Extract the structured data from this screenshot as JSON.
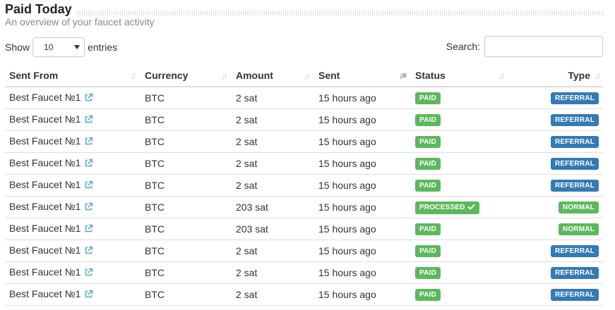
{
  "header": {
    "title": "Paid Today",
    "subtitle": "An overview of your faucet activity"
  },
  "length": {
    "show_label": "Show",
    "selected": "10",
    "entries_label": "entries"
  },
  "search": {
    "label": "Search:",
    "value": ""
  },
  "table": {
    "columns": [
      "Sent From",
      "Currency",
      "Amount",
      "Sent",
      "Status",
      "Type"
    ],
    "active_sort_column": "Sent",
    "rows": [
      {
        "from": "Best Faucet №1",
        "currency": "BTC",
        "amount": "2 sat",
        "sent": "15 hours ago",
        "status": "PAID",
        "type": "REFERRAL"
      },
      {
        "from": "Best Faucet №1",
        "currency": "BTC",
        "amount": "2 sat",
        "sent": "15 hours ago",
        "status": "PAID",
        "type": "REFERRAL"
      },
      {
        "from": "Best Faucet №1",
        "currency": "BTC",
        "amount": "2 sat",
        "sent": "15 hours ago",
        "status": "PAID",
        "type": "REFERRAL"
      },
      {
        "from": "Best Faucet №1",
        "currency": "BTC",
        "amount": "2 sat",
        "sent": "15 hours ago",
        "status": "PAID",
        "type": "REFERRAL"
      },
      {
        "from": "Best Faucet №1",
        "currency": "BTC",
        "amount": "2 sat",
        "sent": "15 hours ago",
        "status": "PAID",
        "type": "REFERRAL"
      },
      {
        "from": "Best Faucet №1",
        "currency": "BTC",
        "amount": "203 sat",
        "sent": "15 hours ago",
        "status": "PROCESSED",
        "type": "NORMAL"
      },
      {
        "from": "Best Faucet №1",
        "currency": "BTC",
        "amount": "203 sat",
        "sent": "15 hours ago",
        "status": "PAID",
        "type": "NORMAL"
      },
      {
        "from": "Best Faucet №1",
        "currency": "BTC",
        "amount": "2 sat",
        "sent": "15 hours ago",
        "status": "PAID",
        "type": "REFERRAL"
      },
      {
        "from": "Best Faucet №1",
        "currency": "BTC",
        "amount": "2 sat",
        "sent": "15 hours ago",
        "status": "PAID",
        "type": "REFERRAL"
      },
      {
        "from": "Best Faucet №1",
        "currency": "BTC",
        "amount": "2 sat",
        "sent": "15 hours ago",
        "status": "PAID",
        "type": "REFERRAL"
      }
    ]
  },
  "icons": {
    "external_link": "external-link-icon",
    "sort": "sort-icon",
    "check": "check-icon"
  },
  "colors": {
    "status_paid": "#5cb85c",
    "type_referral": "#337ab7",
    "type_normal": "#5cb85c"
  }
}
